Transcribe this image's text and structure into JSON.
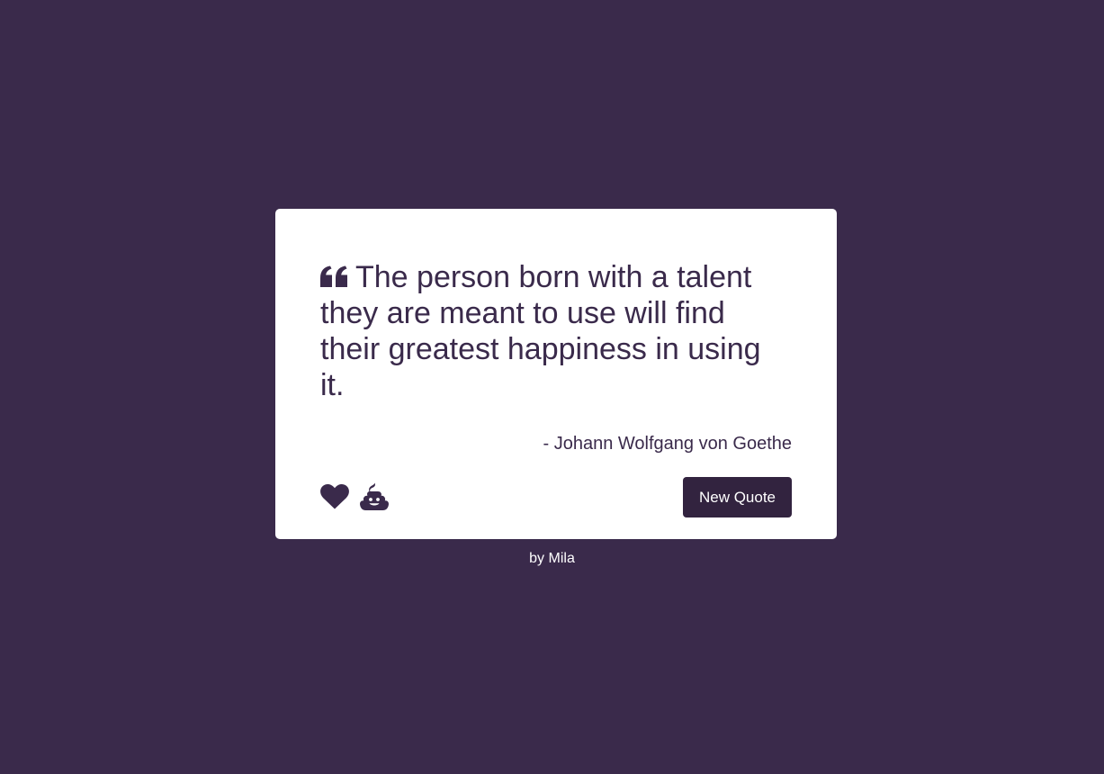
{
  "quote": {
    "text": "The person born with a talent they are meant to use will find their greatest happiness in using it.",
    "author": "- Johann Wolfgang von Goethe",
    "icon": "quote-left-icon"
  },
  "actions": {
    "like_icon": "heart-icon",
    "dislike_icon": "poop-icon",
    "new_quote_label": "New Quote"
  },
  "footer": {
    "credit": "by Mila"
  },
  "colors": {
    "background": "#3a2a4b",
    "card": "#ffffff",
    "text": "#3a2a4b",
    "button": "#32233f",
    "button_text": "#ffffff"
  }
}
